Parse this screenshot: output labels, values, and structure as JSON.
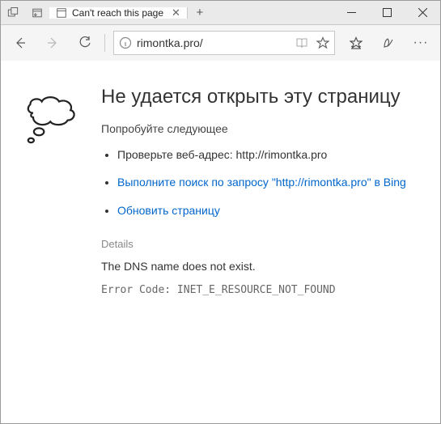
{
  "tab": {
    "title": "Can't reach this page"
  },
  "address": {
    "url": "rimontka.pro/"
  },
  "page": {
    "heading": "Не удается открыть эту страницу",
    "try_label": "Попробуйте следующее",
    "suggestions": {
      "check_prefix": "Проверьте веб-адрес: ",
      "check_url": "http://rimontka.pro",
      "search_link": "Выполните поиск по запросу \"http://rimontka.pro\" в Bing",
      "refresh_link": "Обновить страницу"
    },
    "details": {
      "label": "Details",
      "message": "The DNS name does not exist.",
      "error_label": "Error Code: ",
      "error_code": "INET_E_RESOURCE_NOT_FOUND"
    }
  }
}
